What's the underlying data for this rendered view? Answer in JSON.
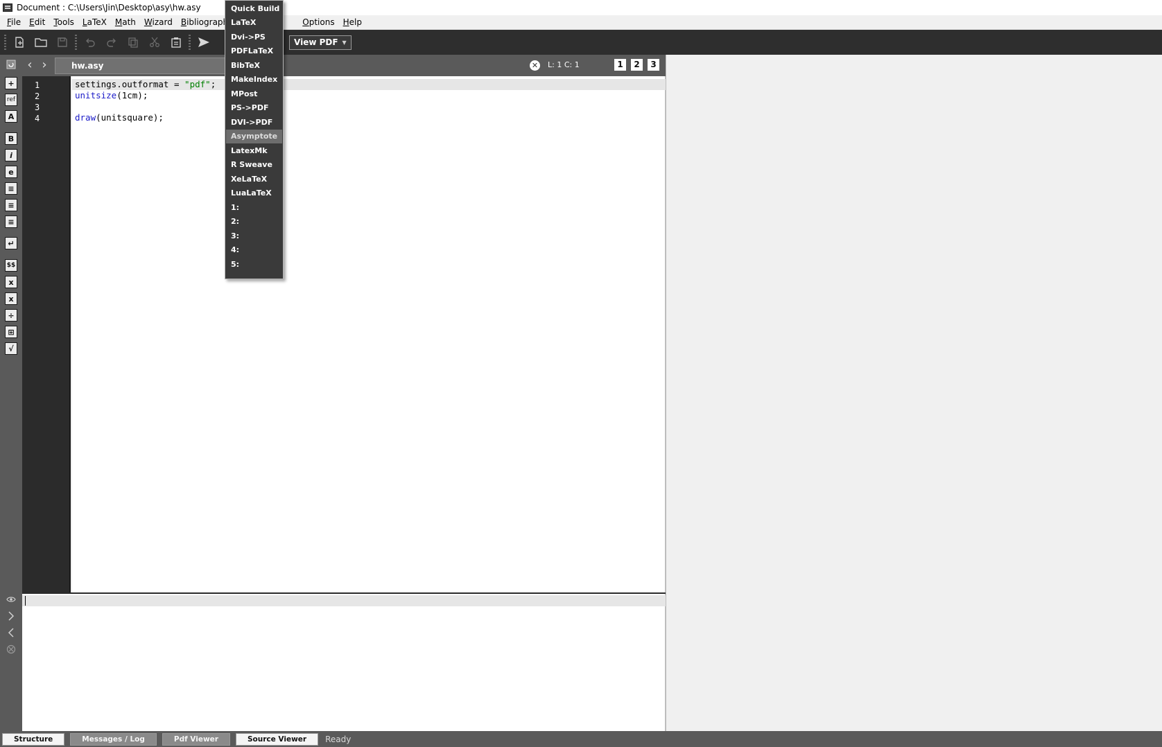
{
  "window": {
    "title": "Document : C:\\Users\\Jin\\Desktop\\asy\\hw.asy"
  },
  "menubar": [
    "File",
    "Edit",
    "Tools",
    "LaTeX",
    "Math",
    "Wizard",
    "Bibliography",
    "",
    "Options",
    "Help"
  ],
  "toolbar": {
    "view_pdf_label": "View PDF"
  },
  "tab": {
    "file_name": "hw.asy",
    "cursor_position": "L: 1 C: 1",
    "views": [
      "1",
      "2",
      "3"
    ]
  },
  "editor": {
    "line_numbers": [
      "1",
      "2",
      "3",
      "4"
    ],
    "lines": [
      {
        "parts": [
          {
            "t": "settings.outformat = ",
            "c": ""
          },
          {
            "t": "\"pdf\"",
            "c": "str"
          },
          {
            "t": ";",
            "c": ""
          }
        ]
      },
      {
        "parts": [
          {
            "t": "unitsize",
            "c": "kw"
          },
          {
            "t": "(1cm);",
            "c": ""
          }
        ]
      },
      {
        "parts": []
      },
      {
        "parts": [
          {
            "t": "draw",
            "c": "kw"
          },
          {
            "t": "(unitsquare);",
            "c": ""
          }
        ]
      }
    ]
  },
  "left_toolbar": {
    "buttons": [
      "+",
      "ref",
      "A",
      "B",
      "i",
      "e",
      "≡",
      "≡",
      "≡",
      "↵",
      "$$",
      "x",
      "x",
      "÷",
      "⊞",
      "√"
    ]
  },
  "statusbar": {
    "tabs": [
      "Structure",
      "Messages / Log",
      "Pdf Viewer",
      "Source Viewer"
    ],
    "status": "Ready"
  },
  "build_menu": {
    "items": [
      "Quick Build",
      "LaTeX",
      "Dvi->PS",
      "PDFLaTeX",
      "BibTeX",
      "MakeIndex",
      "MPost",
      "PS->PDF",
      "DVI->PDF",
      "Asymptote",
      "LatexMk",
      "R Sweave",
      "XeLaTeX",
      "LuaLaTeX",
      "1:",
      "2:",
      "3:",
      "4:",
      "5:"
    ],
    "highlighted": "Asymptote"
  }
}
